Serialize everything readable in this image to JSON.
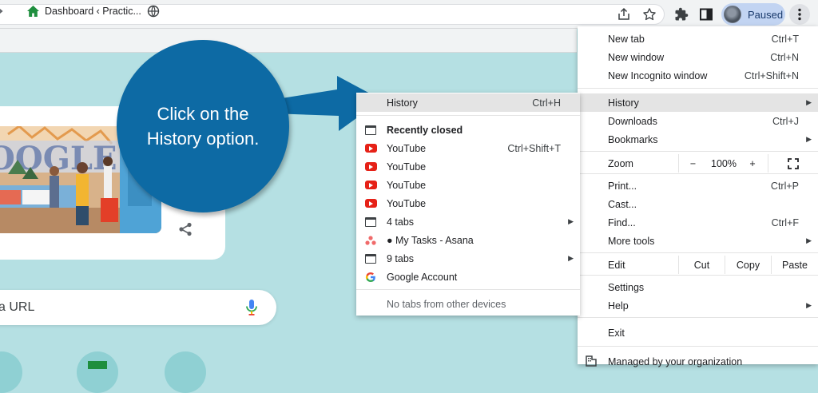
{
  "toolbar": {
    "profile_label": "Paused"
  },
  "bookmarks": {
    "dashboard_label": "Dashboard ‹ Practic..."
  },
  "search": {
    "partial_text": "a URL"
  },
  "callout": {
    "line1": "Click on the",
    "line2": "History option."
  },
  "chrome_menu": {
    "new_tab": {
      "label": "New tab",
      "shortcut": "Ctrl+T"
    },
    "new_window": {
      "label": "New window",
      "shortcut": "Ctrl+N"
    },
    "new_incognito": {
      "label": "New Incognito window",
      "shortcut": "Ctrl+Shift+N"
    },
    "history": {
      "label": "History"
    },
    "downloads": {
      "label": "Downloads",
      "shortcut": "Ctrl+J"
    },
    "bookmarks": {
      "label": "Bookmarks"
    },
    "zoom": {
      "label": "Zoom",
      "minus": "−",
      "level": "100%",
      "plus": "+"
    },
    "print": {
      "label": "Print...",
      "shortcut": "Ctrl+P"
    },
    "cast": {
      "label": "Cast..."
    },
    "find": {
      "label": "Find...",
      "shortcut": "Ctrl+F"
    },
    "more_tools": {
      "label": "More tools"
    },
    "edit": {
      "label": "Edit",
      "cut": "Cut",
      "copy": "Copy",
      "paste": "Paste"
    },
    "settings": {
      "label": "Settings"
    },
    "help": {
      "label": "Help"
    },
    "exit": {
      "label": "Exit"
    },
    "managed": {
      "label": "Managed by your organization"
    }
  },
  "history_menu": {
    "history": {
      "label": "History",
      "shortcut": "Ctrl+H"
    },
    "recently_closed": "Recently closed",
    "items": [
      {
        "label": "YouTube",
        "shortcut": "Ctrl+Shift+T",
        "icon": "youtube-icon"
      },
      {
        "label": "YouTube",
        "shortcut": "",
        "icon": "youtube-icon"
      },
      {
        "label": "YouTube",
        "shortcut": "",
        "icon": "youtube-icon"
      },
      {
        "label": "YouTube",
        "shortcut": "",
        "icon": "youtube-icon"
      },
      {
        "label": "4 tabs",
        "shortcut": "",
        "icon": "tabs-icon"
      },
      {
        "label": "● My Tasks - Asana",
        "shortcut": "",
        "icon": "asana-icon"
      },
      {
        "label": "9 tabs",
        "shortcut": "",
        "icon": "tabs-icon"
      },
      {
        "label": "Google Account",
        "shortcut": "",
        "icon": "google-icon"
      }
    ],
    "no_tabs": "No tabs from other devices"
  },
  "colors": {
    "page_bg": "#b5e0e3",
    "callout": "#0d6aa4",
    "youtube": "#e62117"
  }
}
